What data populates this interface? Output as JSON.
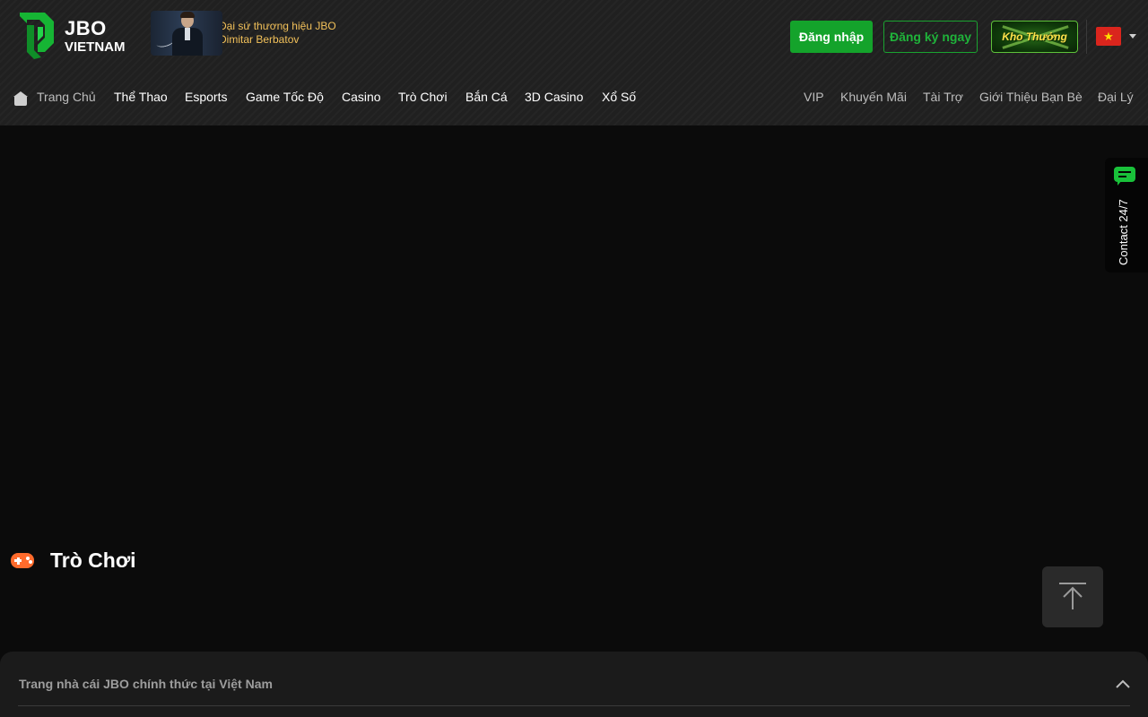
{
  "brand": {
    "logo_top": "JBO",
    "logo_bottom": "VIETNAM"
  },
  "ambassador": {
    "line1": "Đại sứ thương hiệu JBO",
    "line2": "Dimitar Berbatov"
  },
  "header_actions": {
    "login_label": "Đăng nhập",
    "register_label": "Đăng ký ngay",
    "reward_label": "Kho Thưởng",
    "language_flag": "★"
  },
  "nav": {
    "left": [
      {
        "label": "Trang Chủ"
      },
      {
        "label": "Thể Thao"
      },
      {
        "label": "Esports"
      },
      {
        "label": "Game Tốc Độ"
      },
      {
        "label": "Casino"
      },
      {
        "label": "Trò Chơi"
      },
      {
        "label": "Bắn Cá"
      },
      {
        "label": "3D Casino"
      },
      {
        "label": "Xổ Số"
      }
    ],
    "right": [
      {
        "label": "VIP"
      },
      {
        "label": "Khuyến Mãi"
      },
      {
        "label": "Tài Trợ"
      },
      {
        "label": "Giới Thiệu Bạn Bè"
      },
      {
        "label": "Đại Lý"
      }
    ]
  },
  "contact": {
    "label": "Contact 24/7"
  },
  "section": {
    "title": "Trò Chơi"
  },
  "footer": {
    "title": "Trang nhà cái JBO chính thức tại Việt Nam"
  },
  "colors": {
    "accent_green": "#14a32b",
    "brand_green": "#1fb33a",
    "ambassador_gold": "#f2c15a",
    "game_icon_orange": "#ff6b2c",
    "page_background": "#0b0b0b",
    "header_background": "#202020"
  },
  "icons": {
    "home": "home-icon",
    "chat": "chat-bubble-icon",
    "gamepad": "gamepad-icon",
    "back_to_top": "arrow-up-icon",
    "collapse": "chevron-up-icon"
  }
}
